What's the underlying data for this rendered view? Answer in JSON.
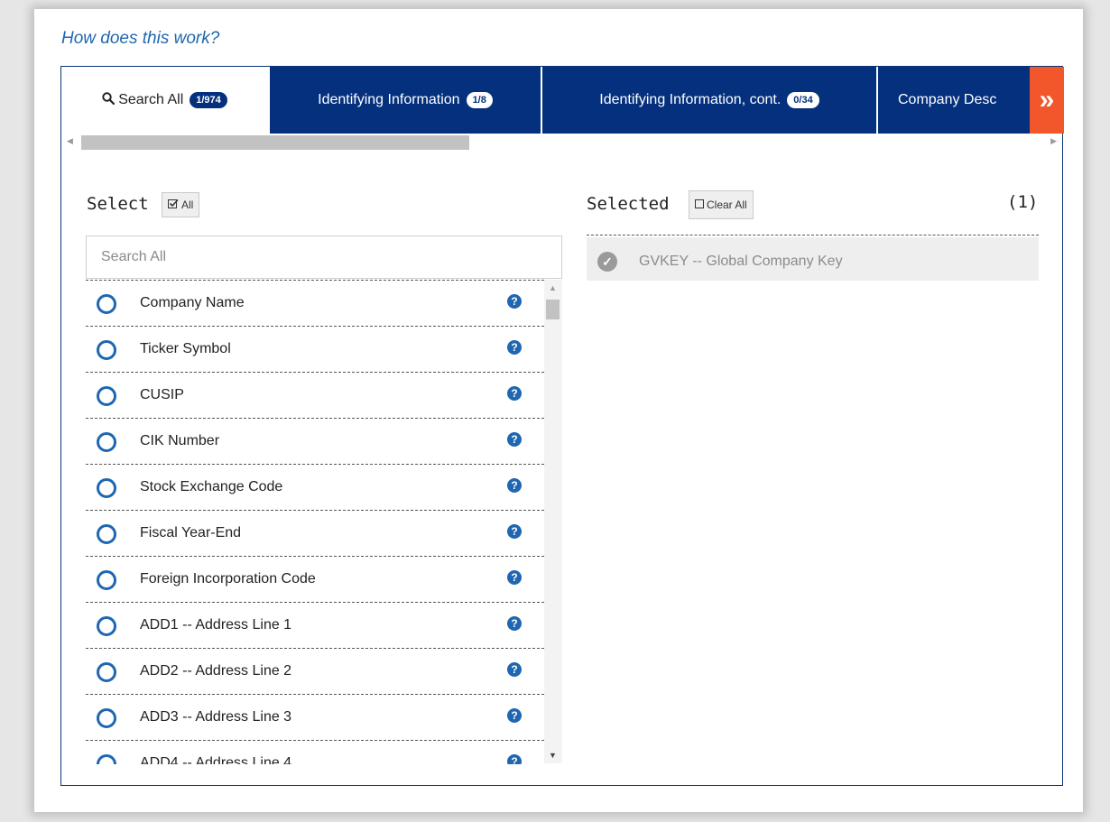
{
  "help_link": "How does this work?",
  "tabs": [
    {
      "label": "Search All",
      "badge": "1/974",
      "icon": "search-icon"
    },
    {
      "label": "Identifying Information",
      "badge": "1/8"
    },
    {
      "label": "Identifying Information, cont.",
      "badge": "0/34"
    },
    {
      "label": "Company Desc"
    }
  ],
  "tab_next_glyph": "»",
  "select_panel": {
    "title": "Select",
    "all_button": "All",
    "search_placeholder": "Search All",
    "items": [
      {
        "label": "Company Name"
      },
      {
        "label": "Ticker Symbol"
      },
      {
        "label": "CUSIP"
      },
      {
        "label": "CIK Number"
      },
      {
        "label": "Stock Exchange Code"
      },
      {
        "label": "Fiscal Year-End"
      },
      {
        "label": "Foreign Incorporation Code"
      },
      {
        "label": "ADD1 -- Address Line 1"
      },
      {
        "label": "ADD2 -- Address Line 2"
      },
      {
        "label": "ADD3 -- Address Line 3"
      },
      {
        "label": "ADD4 -- Address Line 4"
      }
    ],
    "help_glyph": "?"
  },
  "selected_panel": {
    "title": "Selected",
    "clear_button": "Clear All",
    "count": "(1)",
    "items": [
      {
        "label": "GVKEY -- Global Company Key"
      }
    ]
  },
  "colors": {
    "navy": "#04307d",
    "accent_orange": "#f1572a",
    "link_blue": "#1f67b1"
  }
}
